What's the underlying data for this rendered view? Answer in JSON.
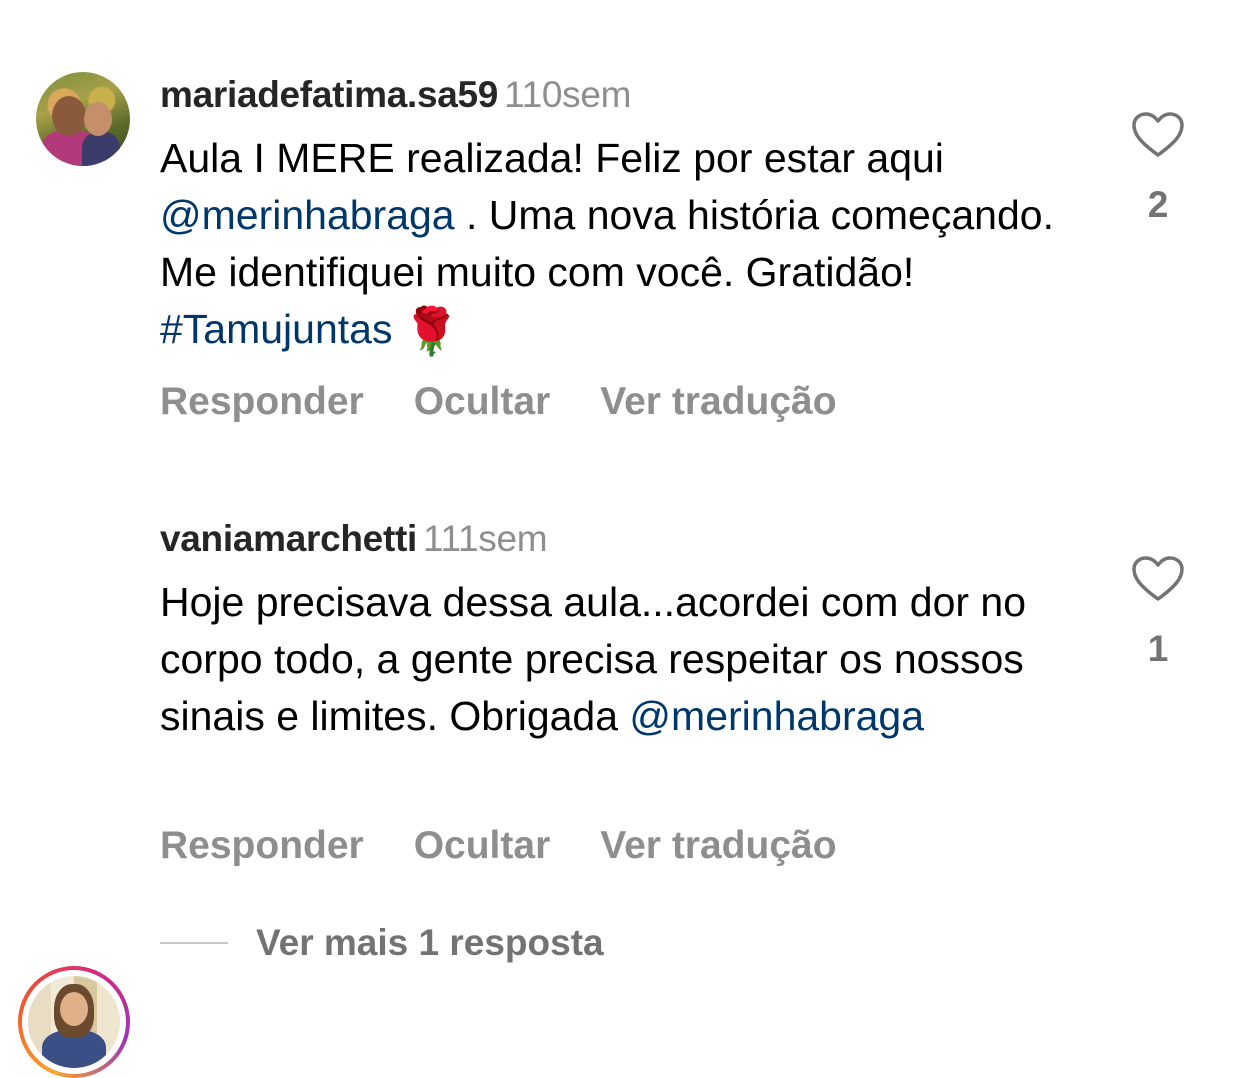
{
  "comments": [
    {
      "username": "mariadefatima.sa59",
      "time": "110sem",
      "text_parts": {
        "p1": "Aula I MERE realizada! Feliz por estar aqui ",
        "mention": "@merinhabraga",
        "p2": " . Uma nova história começando. Me identifiquei muito com você. Gratidão! ",
        "hashtag": "#Tamujuntas",
        "emoji": "🌹"
      },
      "likes": "2",
      "actions": {
        "reply": "Responder",
        "hide": "Ocultar",
        "translate": "Ver tradução"
      }
    },
    {
      "username": "vaniamarchetti",
      "time": "111sem",
      "text_parts": {
        "p1": "Hoje precisava dessa aula...acordei com dor no corpo todo, a gente precisa respeitar os nossos sinais e limites. Obrigada ",
        "mention": "@merinhabraga"
      },
      "likes": "1",
      "actions": {
        "reply": "Responder",
        "hide": "Ocultar",
        "translate": "Ver tradução"
      },
      "story_ring": true
    }
  ],
  "view_more": {
    "label": "Ver mais 1 resposta"
  },
  "icons": {
    "like": "heart-outline-icon"
  },
  "colors": {
    "link": "#00376b",
    "muted": "#8e8e8e",
    "text": "#000000"
  }
}
